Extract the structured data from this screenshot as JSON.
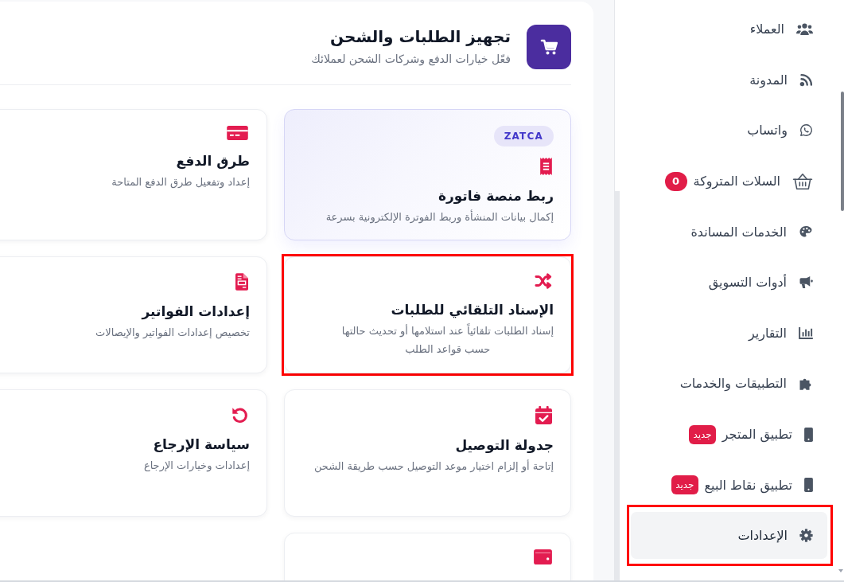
{
  "header": {
    "title": "تجهيز الطلبات والشحن",
    "subtitle": "فعّل خيارات الدفع وشركات الشحن لعملائك"
  },
  "cards": [
    {
      "kind": "featured",
      "badge": "ZATCA",
      "title": "ربط منصة فاتورة",
      "description": "إكمال بيانات المنشأة وربط الفوترة الإلكترونية بسرعة",
      "highlighted": false
    },
    {
      "kind": "standard",
      "title": "طرق الدفع",
      "description": "إعداد وتفعيل طرق الدفع المتاحة",
      "highlighted": false
    },
    {
      "kind": "standard",
      "title": "الإسناد التلقائي للطلبات",
      "description": "إسناد الطلبات تلقائياً عند استلامها أو تحديث حالتها\nحسب قواعد الطلب",
      "highlighted": true
    },
    {
      "kind": "standard",
      "title": "إعدادات الفواتير",
      "description": "تخصيص إعدادات الفواتير والإيصالات",
      "highlighted": false
    },
    {
      "kind": "standard",
      "title": "جدولة التوصيل",
      "description": "إتاحة أو إلزام اختيار موعد التوصيل حسب طريقة الشحن",
      "highlighted": false
    },
    {
      "kind": "standard",
      "title": "سياسة الإرجاع",
      "description": "إعدادات وخيارات الإرجاع",
      "highlighted": false
    },
    {
      "kind": "standard",
      "highlighted": false
    }
  ],
  "sidebar": {
    "items": [
      {
        "label": "العملاء",
        "selected": false,
        "highlighted": false
      },
      {
        "label": "المدونة",
        "selected": false,
        "highlighted": false
      },
      {
        "label": "واتساب",
        "selected": false,
        "highlighted": false
      },
      {
        "label": "السلات المتروكة",
        "selected": false,
        "highlighted": false,
        "badge": {
          "kind": "count",
          "text": "0"
        }
      },
      {
        "label": "الخدمات المساندة",
        "selected": false,
        "highlighted": false
      },
      {
        "label": "أدوات التسويق",
        "selected": false,
        "highlighted": false
      },
      {
        "label": "التقارير",
        "selected": false,
        "highlighted": false
      },
      {
        "label": "التطبيقات والخدمات",
        "selected": false,
        "highlighted": false
      },
      {
        "label": "تطبيق المتجر",
        "selected": false,
        "highlighted": false,
        "badge": {
          "kind": "new",
          "text": "جديد"
        }
      },
      {
        "label": "تطبيق نقاط البيع",
        "selected": false,
        "highlighted": false,
        "badge": {
          "kind": "new",
          "text": "جديد"
        }
      },
      {
        "label": "الإعدادات",
        "selected": true,
        "highlighted": true
      }
    ]
  }
}
